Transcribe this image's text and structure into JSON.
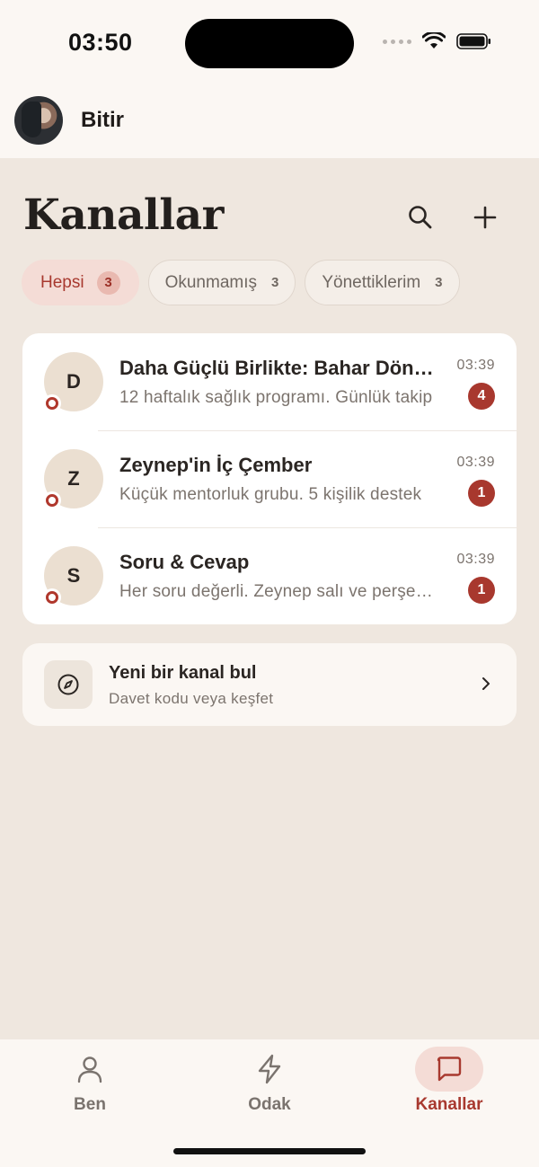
{
  "status_bar": {
    "time": "03:50"
  },
  "header": {
    "username": "Bitir"
  },
  "page": {
    "title": "Kanallar"
  },
  "filters": [
    {
      "label": "Hepsi",
      "count": "3",
      "active": true
    },
    {
      "label": "Okunmamış",
      "count": "3",
      "active": false
    },
    {
      "label": "Yönettiklerim",
      "count": "3",
      "active": false
    }
  ],
  "channels": [
    {
      "initial": "D",
      "title": "Daha Güçlü Birlikte: Bahar Dönemi",
      "preview": "12 haftalık sağlık programı. Günlük takip",
      "time": "03:39",
      "unread": "4"
    },
    {
      "initial": "Z",
      "title": "Zeynep'in İç Çember",
      "preview": "Küçük mentorluk grubu. 5 kişilik destek",
      "time": "03:39",
      "unread": "1"
    },
    {
      "initial": "S",
      "title": "Soru & Cevap",
      "preview": "Her soru değerli. Zeynep salı ve perşembe",
      "time": "03:39",
      "unread": "1"
    }
  ],
  "discover": {
    "title": "Yeni bir kanal bul",
    "subtitle": "Davet kodu veya keşfet"
  },
  "tabs": [
    {
      "label": "Ben",
      "icon": "person-icon"
    },
    {
      "label": "Odak",
      "icon": "lightning-icon"
    },
    {
      "label": "Kanallar",
      "icon": "chat-bubble-icon",
      "active": true
    }
  ],
  "colors": {
    "accent": "#a8382e",
    "background": "#efe7df",
    "surface": "#fbf7f3"
  }
}
